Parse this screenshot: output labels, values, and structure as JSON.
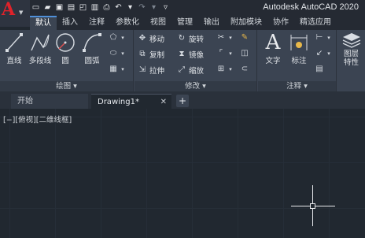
{
  "app": {
    "title": "Autodesk AutoCAD 2020"
  },
  "ribbon_tabs": [
    "默认",
    "插入",
    "注释",
    "参数化",
    "视图",
    "管理",
    "输出",
    "附加模块",
    "协作",
    "精选应用"
  ],
  "draw_panel": {
    "title": "绘图",
    "tools": {
      "line": "直线",
      "polyline": "多段线",
      "circle": "圆",
      "arc": "圆弧"
    }
  },
  "modify_panel": {
    "title": "修改",
    "tools": {
      "move": "移动",
      "rotate": "旋转",
      "copy": "复制",
      "mirror": "镜像",
      "stretch": "拉伸",
      "scale": "缩放"
    }
  },
  "annotation_panel": {
    "title": "注释",
    "tools": {
      "text": "文字",
      "dimension": "标注"
    }
  },
  "layers_panel": {
    "properties": "图层\n特性"
  },
  "file_tabs": {
    "start": "开始",
    "drawing": "Drawing1*",
    "close": "✕",
    "add": "+"
  },
  "viewport": {
    "controls": "[−][俯视][二维线框]"
  }
}
